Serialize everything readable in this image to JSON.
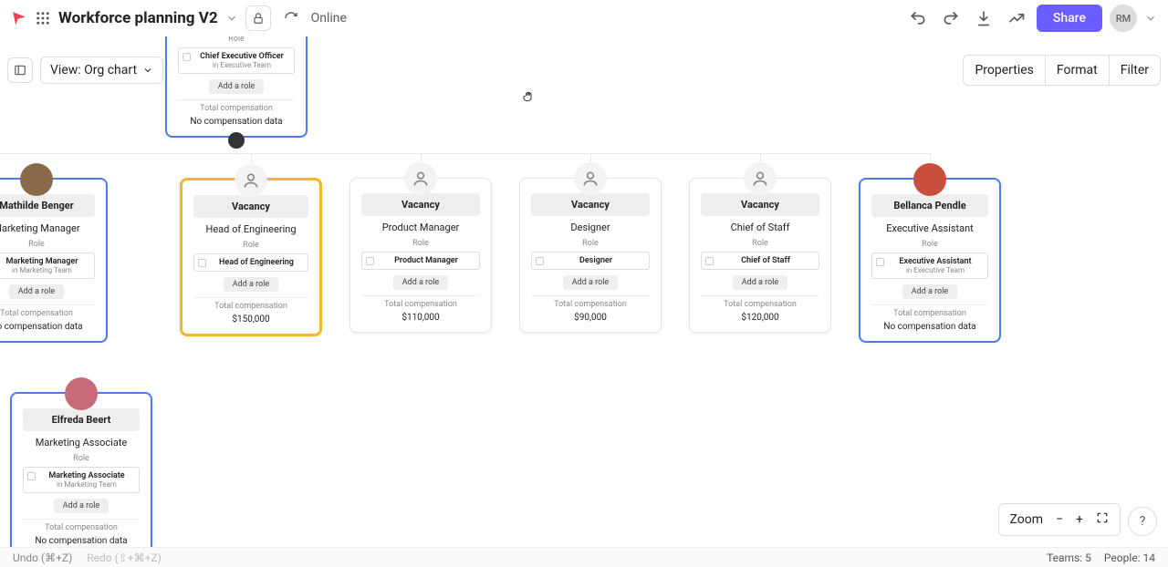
{
  "header": {
    "title": "Workforce planning V2",
    "online": "Online",
    "share": "Share",
    "user_initials": "RM"
  },
  "toolbar": {
    "view_label": "View: Org chart",
    "properties": "Properties",
    "format": "Format",
    "filter": "Filter"
  },
  "labels": {
    "role": "Role",
    "add_role": "Add a role",
    "total_comp": "Total compensation",
    "no_comp": "No compensation data",
    "vacancy": "Vacancy"
  },
  "cards": {
    "ceo": {
      "title": "Chief Executive Officer",
      "team": "in Executive Team"
    },
    "mathilde": {
      "name": "Mathilde Benger",
      "subtitle": "Marketing Manager",
      "role_title": "Marketing Manager",
      "role_team": "in Marketing Team"
    },
    "head_eng": {
      "subtitle": "Head of Engineering",
      "role_title": "Head of Engineering",
      "comp": "$150,000"
    },
    "pm": {
      "subtitle": "Product Manager",
      "role_title": "Product Manager",
      "comp": "$110,000"
    },
    "designer": {
      "subtitle": "Designer",
      "role_title": "Designer",
      "comp": "$90,000"
    },
    "cos": {
      "subtitle": "Chief of Staff",
      "role_title": "Chief of Staff",
      "comp": "$120,000"
    },
    "bellanca": {
      "name": "Bellanca Pendle",
      "subtitle": "Executive Assistant",
      "role_title": "Executive Assistant",
      "role_team": "in Executive Team"
    },
    "elfreda": {
      "name": "Elfreda Beert",
      "subtitle": "Marketing Associate",
      "role_title": "Marketing Associate",
      "role_team": "in Marketing Team"
    }
  },
  "zoom": {
    "label": "Zoom"
  },
  "status": {
    "undo": "Undo (⌘+Z)",
    "redo": "Redo (⇧+⌘+Z)",
    "teams": "Teams: 5",
    "people": "People: 14"
  }
}
